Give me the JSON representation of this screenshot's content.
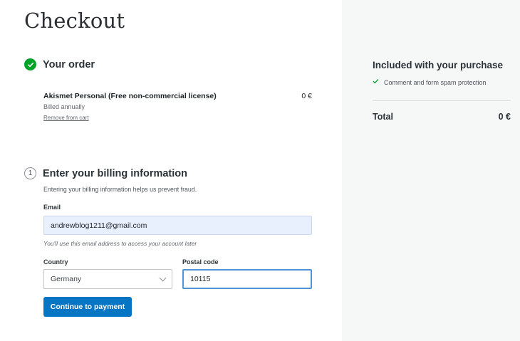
{
  "page": {
    "title": "Checkout"
  },
  "order": {
    "heading": "Your order",
    "product_name": "Akismet Personal (Free non-commercial license)",
    "price": "0 €",
    "billing_period": "Billed annually",
    "remove_link": "Remove from cart"
  },
  "billing": {
    "step_number": "1",
    "heading": "Enter your billing information",
    "helper": "Entering your billing information helps us prevent fraud.",
    "email_label": "Email",
    "email_value": "andrewblog1211@gmail.com",
    "email_hint": "You'll use this email address to access your account later",
    "country_label": "Country",
    "country_value": "Germany",
    "postal_label": "Postal code",
    "postal_value": "10115",
    "continue_button": "Continue to payment"
  },
  "summary": {
    "included_heading": "Included with your purchase",
    "included_items": [
      "Comment and form spam protection"
    ],
    "total_label": "Total",
    "total_value": "0 €"
  },
  "colors": {
    "accent": "#0675c4",
    "success": "#00a32a",
    "sidebar_bg": "#f6f7f7",
    "email_autofill_bg": "#e8f0fe"
  },
  "icons": {
    "order_status": "checkmark-circle-icon",
    "country_dropdown": "chevron-down-icon",
    "included_item": "checkmark-icon"
  }
}
